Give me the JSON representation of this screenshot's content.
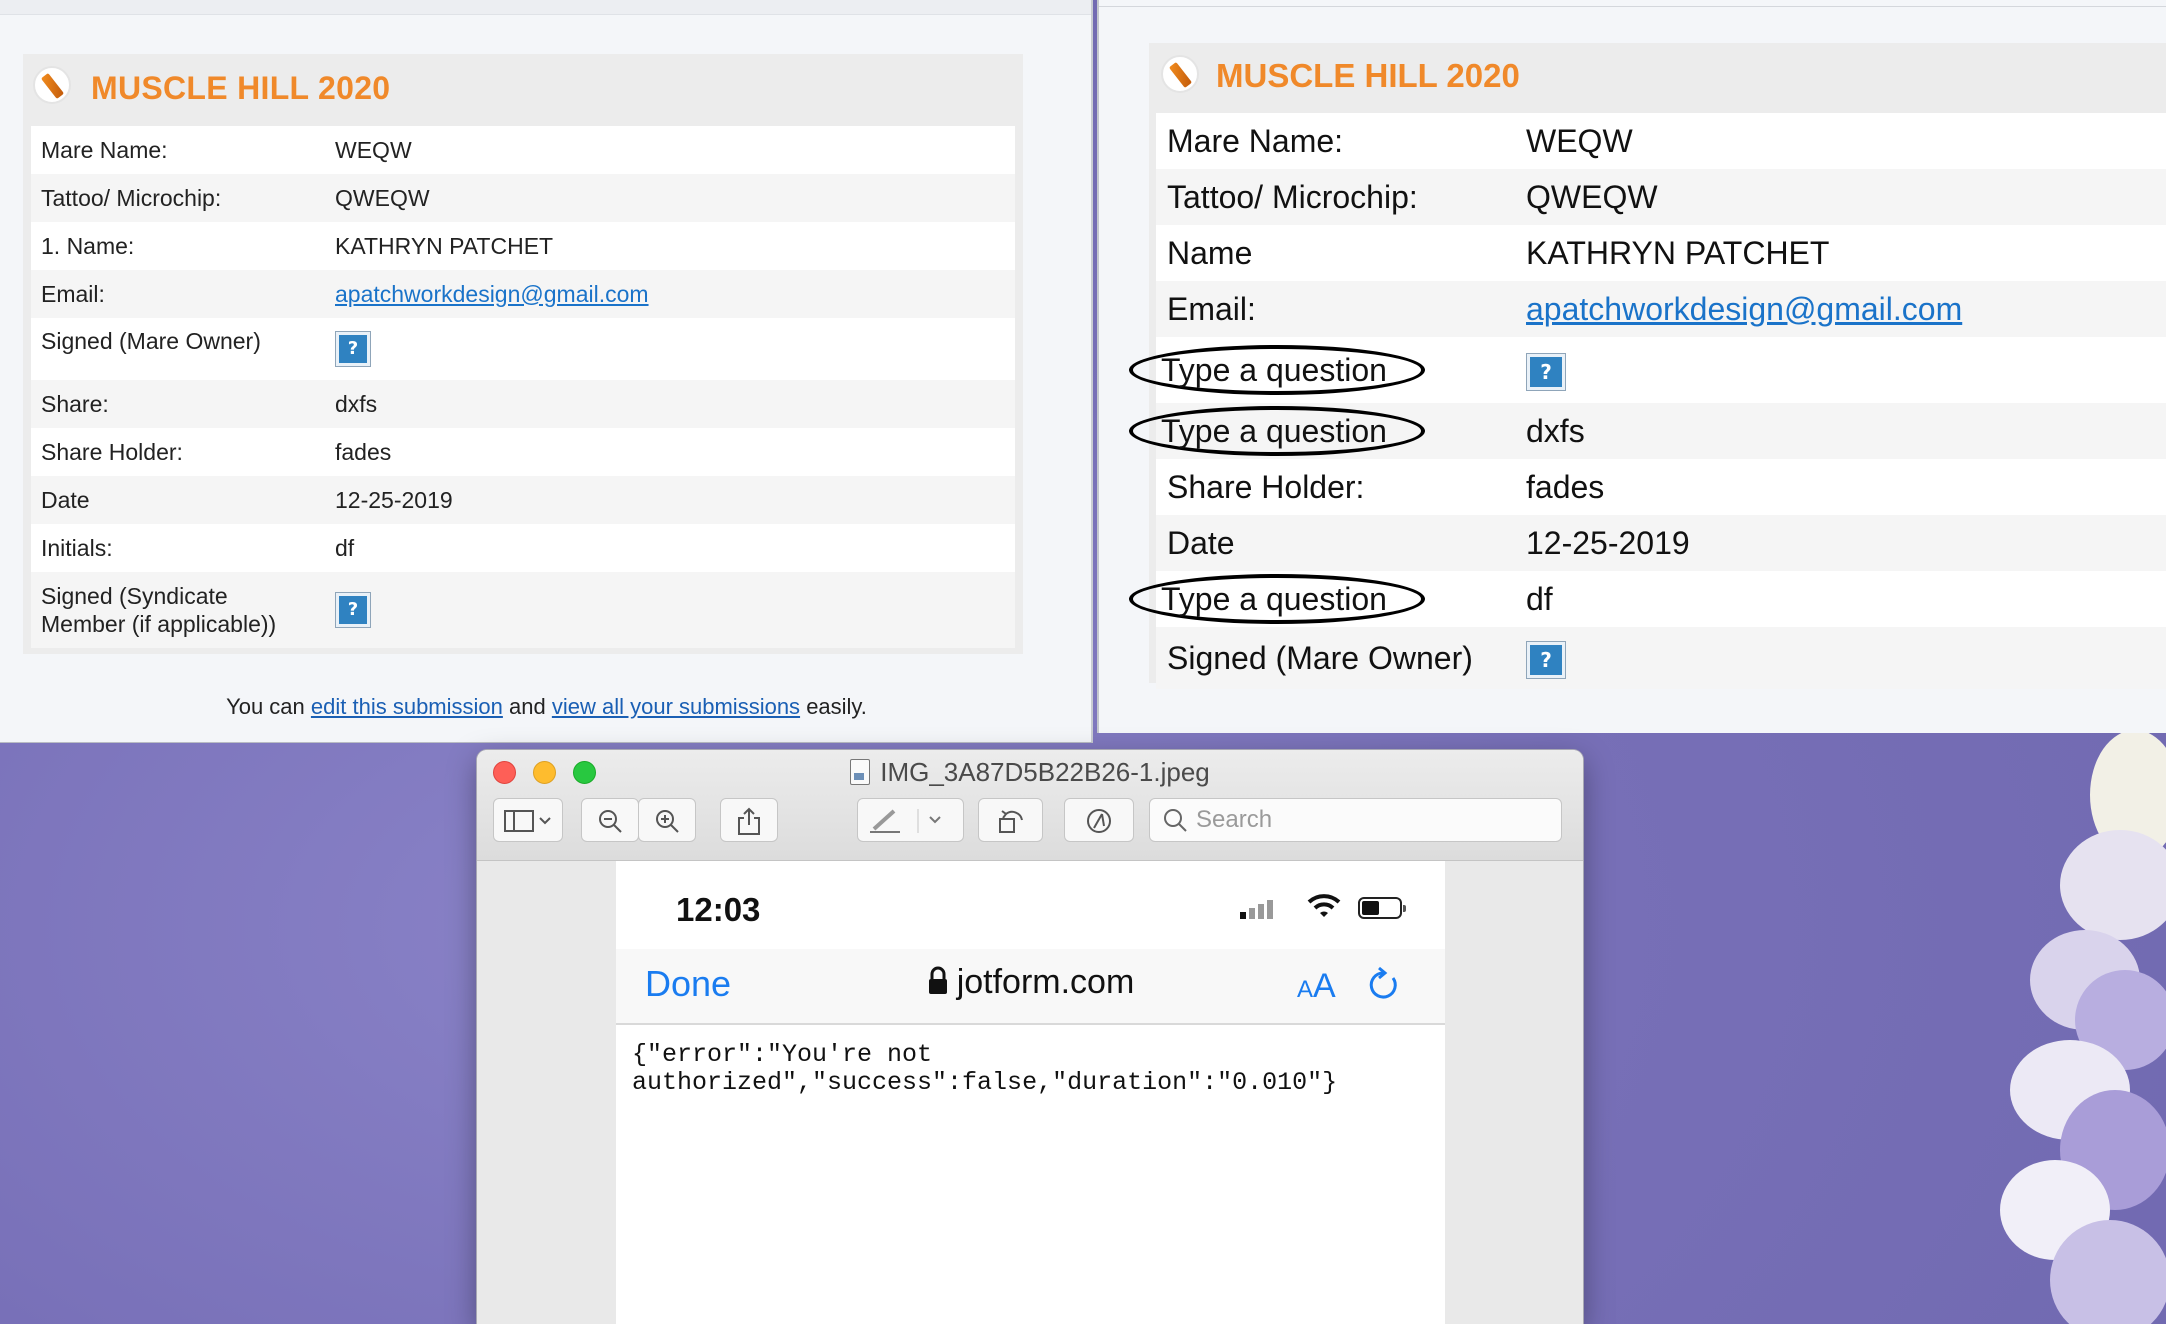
{
  "left_form": {
    "title": "MUSCLE HILL 2020",
    "rows": [
      {
        "label": "Mare Name:",
        "value": "WEQW"
      },
      {
        "label": "Tattoo/ Microchip:",
        "value": "QWEQW"
      },
      {
        "label": "1. Name:",
        "value": "KATHRYN PATCHET"
      },
      {
        "label": "Email:",
        "value": "apatchworkdesign@gmail.com"
      },
      {
        "label": "Signed (Mare Owner)",
        "value": "?"
      },
      {
        "label": "Share:",
        "value": "dxfs"
      },
      {
        "label": "Share Holder:",
        "value": "fades"
      },
      {
        "label": "Date",
        "value": "12-25-2019"
      },
      {
        "label": "Initials:",
        "value": "df"
      },
      {
        "label_line1": "Signed (Syndicate",
        "label_line2": "Member (if applicable))",
        "value": "?"
      }
    ],
    "footer": {
      "prefix": "You can",
      "edit_link": "edit this submission",
      "middle": "and",
      "view_link": "view all your submissions",
      "suffix": "easily."
    }
  },
  "right_form": {
    "title": "MUSCLE HILL 2020",
    "rows": [
      {
        "label": "Mare Name:",
        "value": "WEQW"
      },
      {
        "label": "Tattoo/ Microchip:",
        "value": "QWEQW"
      },
      {
        "label": "Name",
        "value": "KATHRYN PATCHET"
      },
      {
        "label": "Email:",
        "value": "apatchworkdesign@gmail.com"
      },
      {
        "label": "Type a question",
        "value": "?"
      },
      {
        "label": "Type a question",
        "value": "dxfs"
      },
      {
        "label": "Share Holder:",
        "value": "fades"
      },
      {
        "label": "Date",
        "value": "12-25-2019"
      },
      {
        "label": "Type a question",
        "value": "df"
      },
      {
        "label": "Signed (Mare Owner)",
        "value": "?"
      }
    ]
  },
  "preview": {
    "file_name": "IMG_3A87D5B22B26-1.jpeg",
    "search_placeholder": "Search",
    "phone": {
      "time": "12:03",
      "done": "Done",
      "domain": "jotform.com",
      "text_size_label_small": "A",
      "text_size_label_large": "A",
      "json_line1": "{\"error\":\"You're not",
      "json_line2": "authorized\",\"success\":false,\"duration\":\"0.010\"}"
    }
  },
  "colors": {
    "title_orange": "#f0892a",
    "link_blue": "#1a73c9",
    "ios_blue": "#1a7cf0",
    "desktop_purple": "#7d76bd"
  },
  "icons": [
    "jotform-pen-logo",
    "help-question-icon",
    "sidebar-icon",
    "zoom-out-icon",
    "zoom-in-icon",
    "share-icon",
    "markup-pen-icon",
    "rotate-icon",
    "markup-circle-icon",
    "search-icon",
    "lock-icon",
    "reload-icon",
    "signal-icon",
    "wifi-icon",
    "battery-icon"
  ]
}
